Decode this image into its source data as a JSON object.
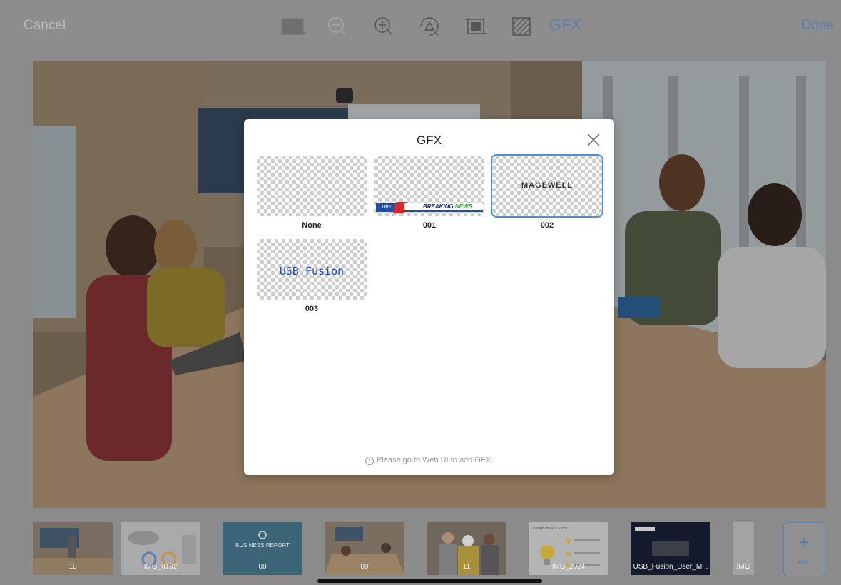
{
  "toolbar": {
    "cancel_label": "Cancel",
    "done_label": "Done",
    "gfx_label": "GFX",
    "accent_color": "#5c7fae"
  },
  "modal": {
    "title": "GFX",
    "items": [
      {
        "label": "None",
        "preview": "transparent"
      },
      {
        "label": "001",
        "preview": "breaking-news",
        "live_text": "LIVE",
        "breaking_text": "BREAKING",
        "news_text": "NEWS"
      },
      {
        "label": "002",
        "preview": "logo",
        "logo_text": "MAGEWELL",
        "selected": true
      },
      {
        "label": "003",
        "preview": "text",
        "overlay_text": "USB Fusion"
      }
    ],
    "footer": "Please go to Web UI to add GFX."
  },
  "filmstrip": {
    "thumbs": [
      {
        "caption": "10"
      },
      {
        "caption": "IMG_0192"
      },
      {
        "caption": "08",
        "title": "BUSINESS REPORT"
      },
      {
        "caption": "09"
      },
      {
        "caption": "11"
      },
      {
        "caption": "IMG_2024",
        "title": "Design Ideas & Shore"
      },
      {
        "caption": "USB_Fusion_User_M..."
      },
      {
        "caption": "IMG"
      }
    ],
    "add_label": "Add"
  }
}
